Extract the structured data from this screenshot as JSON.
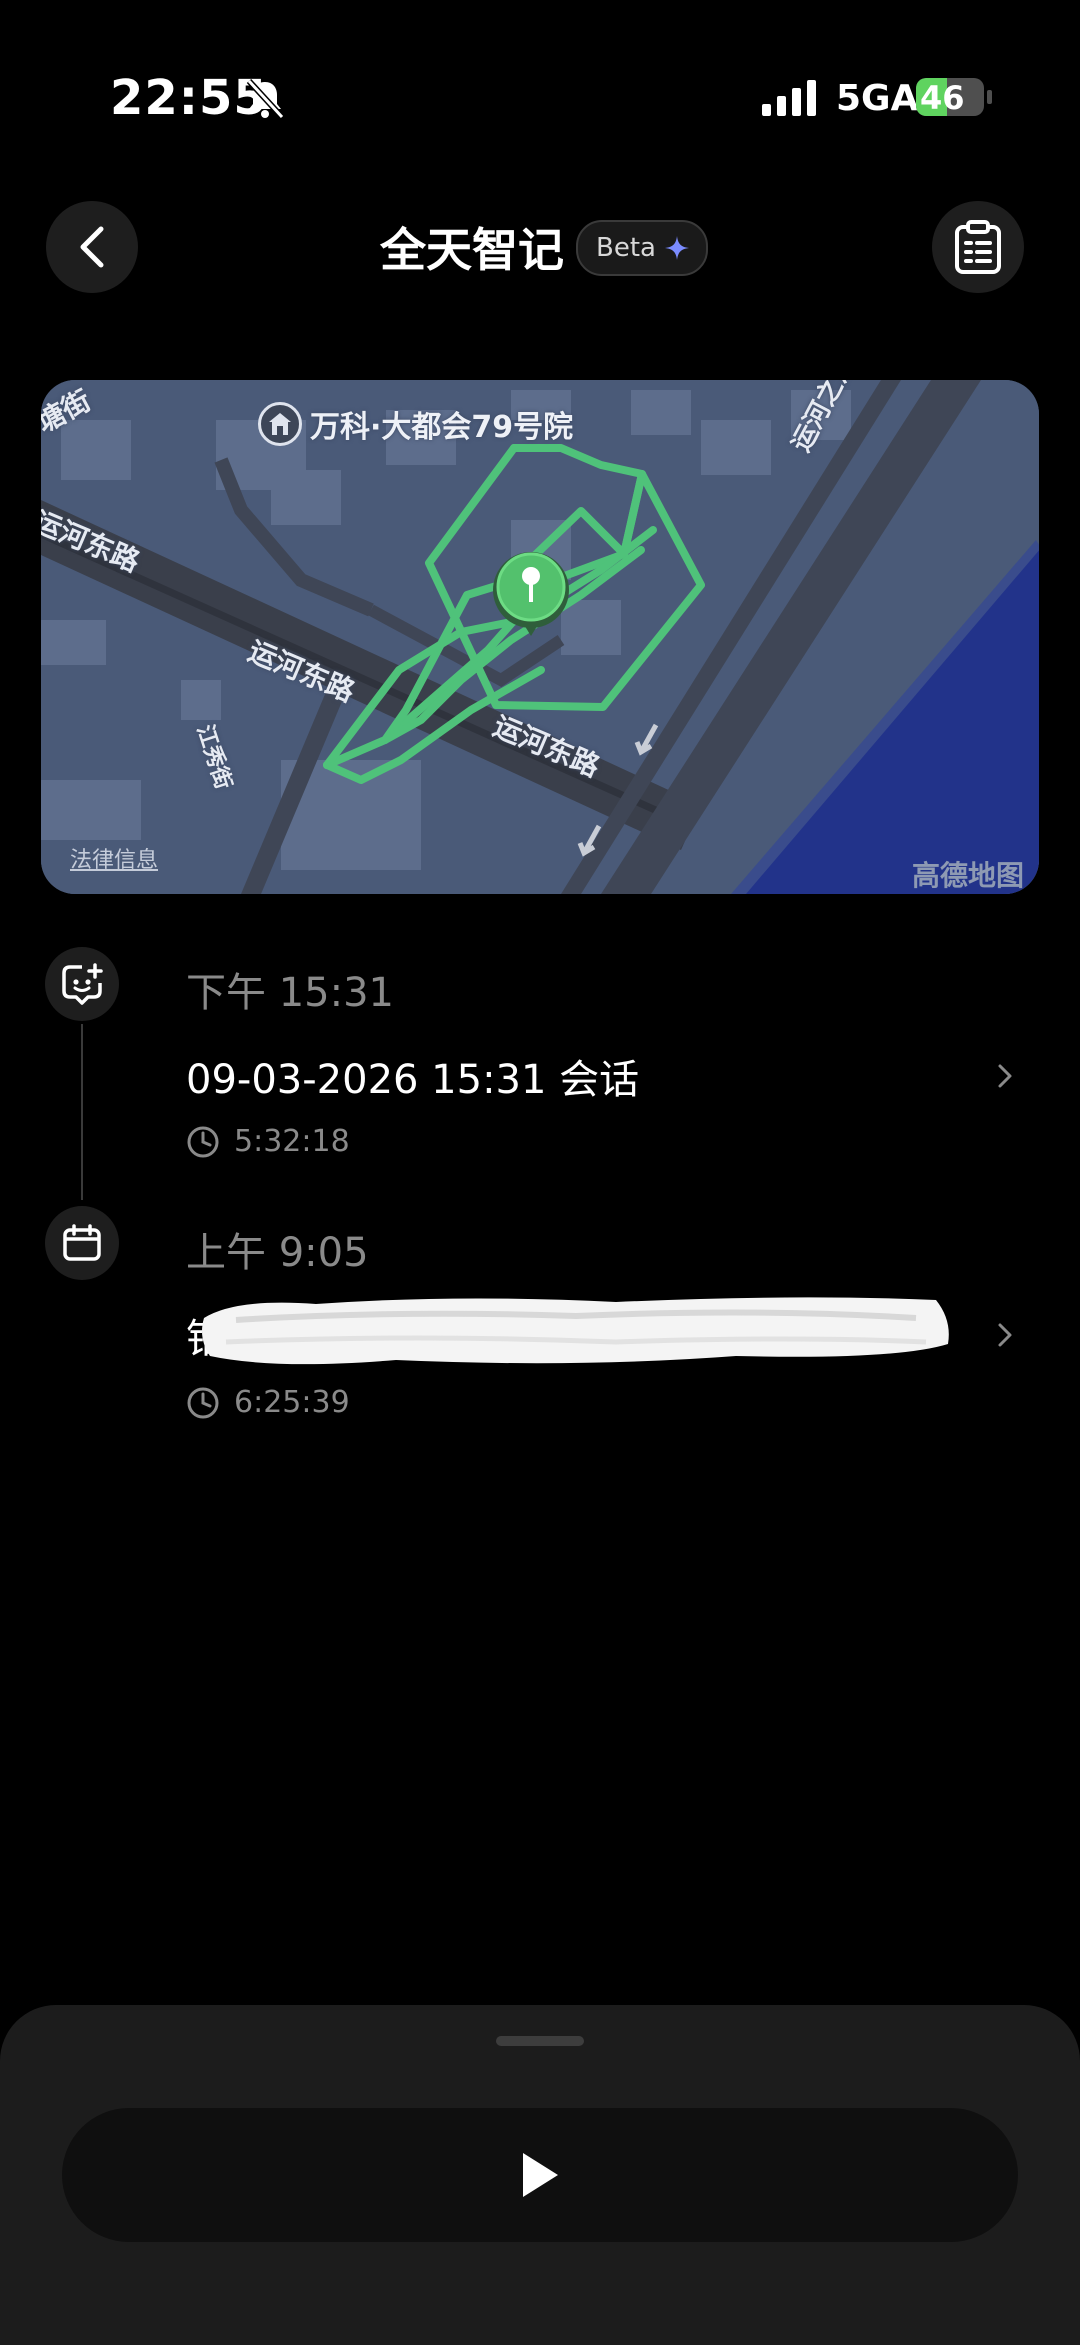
{
  "status_bar": {
    "time": "22:55",
    "network": "5GA",
    "battery_level": "46",
    "battery_fraction": 0.46,
    "icons": [
      "bell-muted-icon",
      "signal-icon",
      "battery-charging-icon"
    ]
  },
  "header": {
    "title": "全天智记",
    "badge": "Beta",
    "left_icon": "back-chevron-icon",
    "right_icon": "clipboard-list-icon",
    "badge_icon": "sparkle-icon"
  },
  "map": {
    "poi_label": "万科·大都会79号院",
    "road_labels": [
      "运河东路",
      "运河东路",
      "运河东路",
      "江秀街",
      "运河之江隧道",
      "塘街"
    ],
    "legal_link": "法律信息",
    "provider": "高德地图",
    "marker_icon": "location-pin-icon",
    "colors": {
      "land": "#4a5a78",
      "water": "#22338a",
      "track": "#4fc27a",
      "road": "#3a3f4b"
    }
  },
  "timeline": [
    {
      "icon": "chat-sparkle-icon",
      "time": "下午 15:31",
      "title": "09-03-2026 15:31 会话",
      "duration": "5:32:18"
    },
    {
      "icon": "calendar-icon",
      "time": "上午 9:05",
      "title": "钻",
      "title_redacted": true,
      "duration": "6:25:39"
    }
  ],
  "player": {
    "play_icon": "play-icon"
  }
}
